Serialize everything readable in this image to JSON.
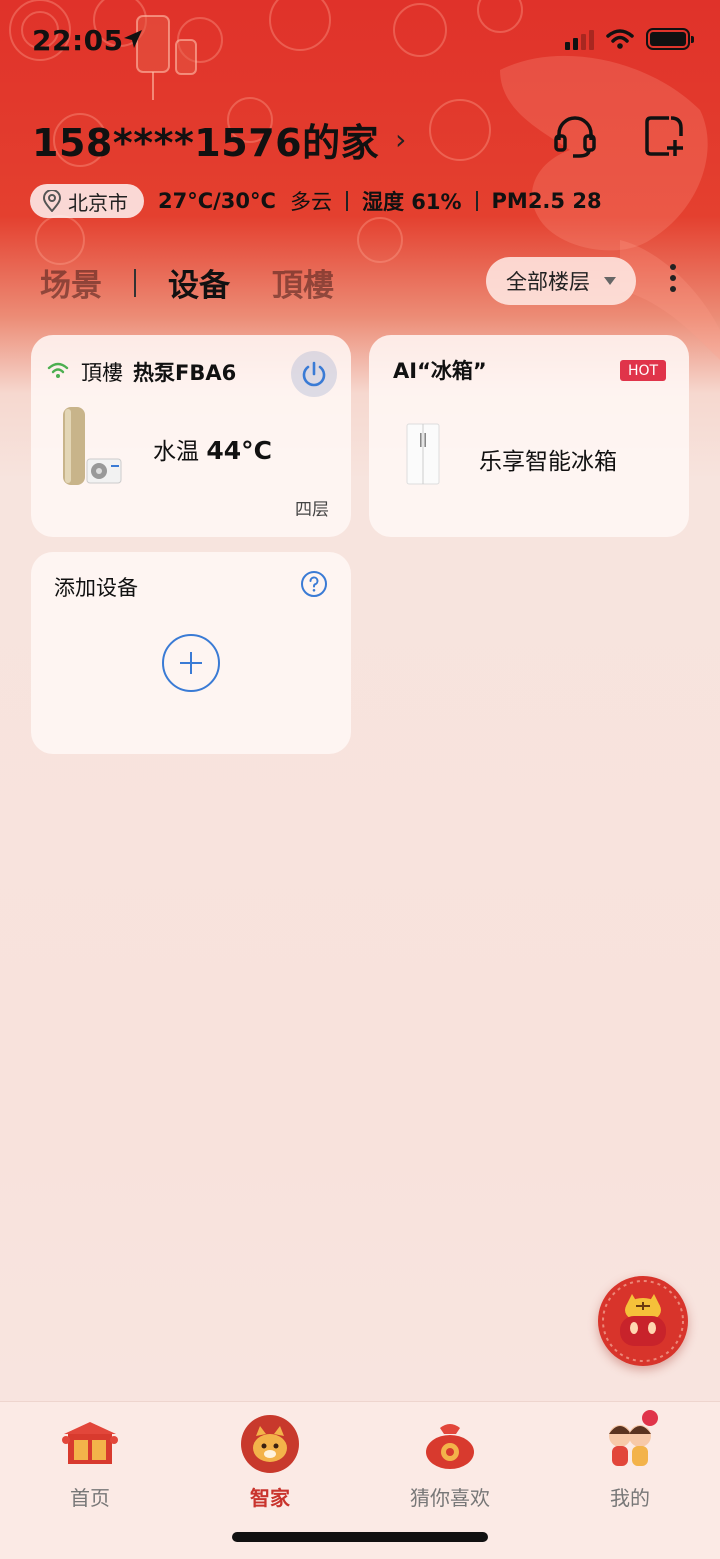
{
  "status_bar": {
    "time": "22:05"
  },
  "header": {
    "home_name": "158****1576的家",
    "chevron": "›"
  },
  "weather": {
    "city": "北京市",
    "temp_range": "27°C/30°C",
    "condition": "多云",
    "humidity": "湿度 61%",
    "pm25": "PM2.5 28"
  },
  "tabs": [
    {
      "label": "场景",
      "active": false
    },
    {
      "label": "设备",
      "active": true
    },
    {
      "label": "頂樓",
      "active": false
    }
  ],
  "floor_filter": {
    "selected": "全部楼层"
  },
  "devices": {
    "heat_pump": {
      "room": "頂樓",
      "model": "热泵FBA6",
      "water_temp_label": "水温",
      "water_temp_value": "44°C",
      "floor": "四层"
    },
    "promo": {
      "title": "AI“冰箱”",
      "badge": "HOT",
      "label": "乐享智能冰箱"
    },
    "add": {
      "title": "添加设备"
    }
  },
  "bottom_nav": [
    {
      "label": "首页",
      "active": false,
      "icon": "home-gate-icon"
    },
    {
      "label": "智家",
      "active": true,
      "icon": "tiger-mascot-icon"
    },
    {
      "label": "猜你喜欢",
      "active": false,
      "icon": "lucky-bag-icon"
    },
    {
      "label": "我的",
      "active": false,
      "icon": "kids-icon",
      "badge": true
    }
  ],
  "colors": {
    "brand_red": "#e0322a",
    "accent_blue": "#3a7bd5",
    "hot_badge": "#e0344a",
    "wifi_green": "#4caf50"
  }
}
